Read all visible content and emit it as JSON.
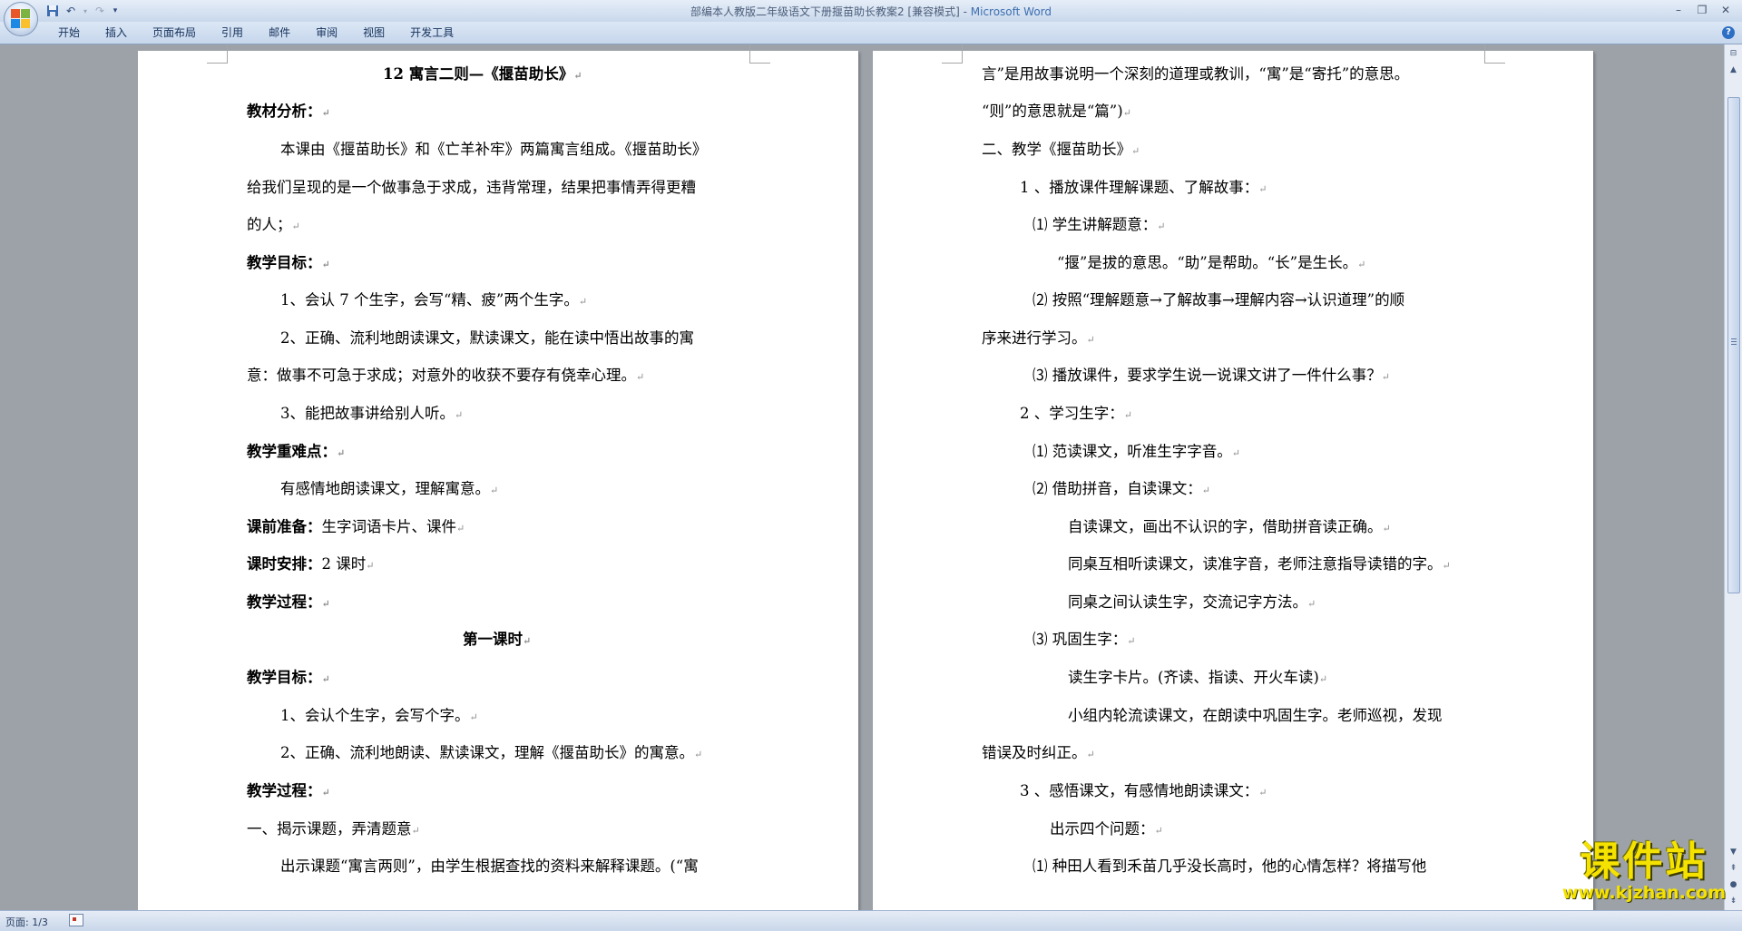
{
  "window": {
    "title": "部编本人教版二年级语文下册揠苗助长教案2 [兼容模式]",
    "app_name": "Microsoft Word",
    "separator": " - "
  },
  "quick_access": [
    "save-icon",
    "undo-icon",
    "redo-icon",
    "customize-icon"
  ],
  "ribbon": {
    "tabs": [
      "开始",
      "插入",
      "页面布局",
      "引用",
      "邮件",
      "审阅",
      "视图",
      "开发工具"
    ]
  },
  "left_page": {
    "lines": [
      "12  寓言二则—《揠苗助长》",
      "教材分析：",
      "本课由《揠苗助长》和《亡羊补牢》两篇寓言组成。《揠苗助长》",
      "给我们呈现的是一个做事急于求成，违背常理，结果把事情弄得更糟",
      "的人；",
      "教学目标：",
      "1、会认 7 个生字，会写“精、疲”两个生字。",
      "2、正确、流利地朗读课文，默读课文，能在读中悟出故事的寓",
      "意：做事不可急于求成；对意外的收获不要存有侥幸心理。",
      "3、能把故事讲给别人听。",
      "教学重难点：",
      "有感情地朗读课文，理解寓意。",
      "生字词语卡片、课件",
      "2 课时",
      "教学过程：",
      "第一课时",
      "教学目标：",
      "1、会认个生字，会写个字。",
      "2、正确、流利地朗读、默读课文，理解《揠苗助长》的寓意。",
      "教学过程：",
      "一、揭示课题，弄清题意",
      "出示课题“寓言两则”，由学生根据查找的资料来解释课题。(“寓"
    ],
    "labels": [
      "课前准备：",
      "课时安排："
    ]
  },
  "right_page": {
    "lines": [
      "言”是用故事说明一个深刻的道理或教训，“寓”是“寄托”的意思。",
      "“则”的意思就是“篇”)",
      "二、教学《揠苗助长》",
      "1 、播放课件理解课题、了解故事：",
      "⑴   学生讲解题意：",
      "“揠”是拔的意思。“助”是帮助。“长”是生长。",
      "⑵   按照“理解题意→了解故事→理解内容→认识道理”的顺",
      "序来进行学习。",
      "⑶   播放课件，要求学生说一说课文讲了一件什么事？",
      "2 、学习生字：",
      "⑴   范读课文，听准生字字音。",
      "⑵   借助拼音，自读课文：",
      "自读课文，画出不认识的字，借助拼音读正确。",
      "同桌互相听读课文，读准字音，老师注意指导读错的字。",
      "同桌之间认读生字，交流记字方法。",
      "⑶   巩固生字：",
      "读生字卡片。(齐读、指读、开火车读)",
      "小组内轮流读课文，在朗读中巩固生字。老师巡视，发现",
      "错误及时纠正。",
      "3 、感悟课文，有感情地朗读课文：",
      "出示四个问题：",
      "⑴   种田人看到禾苗几乎没长高时，他的心情怎样？将描写他"
    ]
  },
  "paragraph_mark": "↵",
  "status": {
    "page": "页面: 1/3"
  },
  "watermark": {
    "title": "课件站",
    "url": "www.kjzhan.com"
  },
  "colors": {
    "title_app": "#3d6fb0",
    "workspace": "#9da2a9",
    "watermark": "#f5e200"
  }
}
